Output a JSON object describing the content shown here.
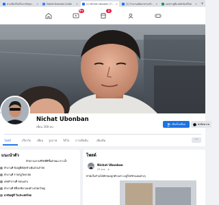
{
  "browser": {
    "tabs": [
      {
        "label": "ทางเลือกใหม่ในการมีบุตรกับ...",
        "active": false,
        "color": "#1877f2"
      },
      {
        "label": "Hotels Business Guide",
        "active": false,
        "color": "#4285f4"
      },
      {
        "label": "(1) Nichat Ubonban | Fac...",
        "active": true,
        "color": "#1877f2"
      },
      {
        "label": "(1) โรงงานผลิตอาหารเสริม...",
        "active": false,
        "color": "#1877f2"
      },
      {
        "label": "เอกสารคู่มือ ผลิตภัณฑ์ใหม่",
        "active": false,
        "color": "#0f9d58"
      }
    ]
  },
  "nav": {
    "home_icon": "home-icon",
    "watch_icon": "video-icon",
    "watch_badge": "9+",
    "marketplace_icon": "store-icon",
    "marketplace_badge": "1",
    "groups_icon": "groups-icon",
    "gaming_icon": "gaming-icon"
  },
  "profile": {
    "name": "Nichat Ubonban",
    "friends": "เพื่อน 308 คน",
    "primary_button": "เพิ่มเป็นเพื่อน",
    "secondary_button": "ส่งข้อความ",
    "accent_color": "#1b74e4"
  },
  "profile_tabs": [
    "โพสต์",
    "เกี่ยวกับ",
    "เพื่อน",
    "รูปภาพ",
    "วิดีโอ",
    "การเช็คอิน",
    "เพิ่มเติม"
  ],
  "intro": {
    "title": "แนะนำตัว",
    "bio": "ทำความภาพชีวิตที่ดีขึ้นด้วยมะเราะน้ำ",
    "items": [
      "ทำงานที่ ยิ่งอยู่ดีมีสุขห้างหุ้นส่วนจำกัด",
      "ทำงานที่ ราชภัฏวิทยาลัย",
      "เคยทำงานที่ ขอนแก่น",
      "ทำงานที่ ดีท็อกซ์ทางดงตำบลโคกใหญ่",
      "อาศัยอยู่ที่ ในประเทศไทย"
    ]
  },
  "posts": {
    "title": "โพสต์",
    "author": "Nichat Ubonban",
    "time": "23 ต.ค.",
    "text": "ท่านั่งในร้านไม้สักของลูกค้าเพราะอยู่ใกล้หัวนอนต่างๆ"
  }
}
